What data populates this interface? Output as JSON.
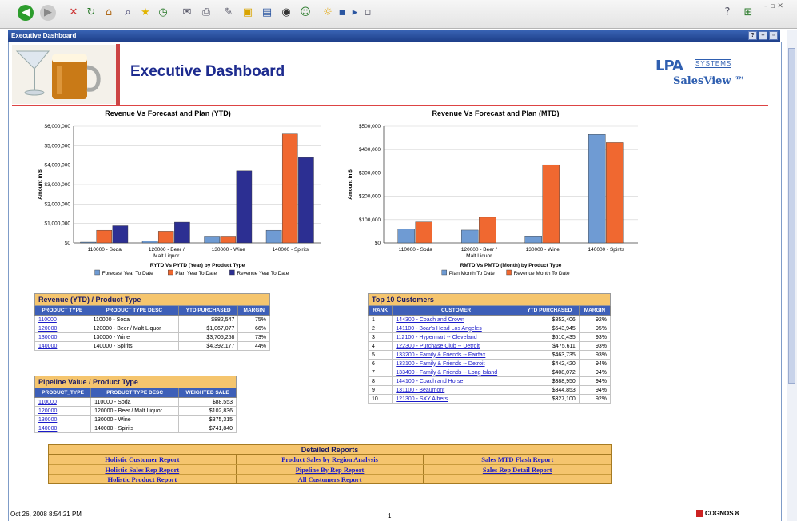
{
  "browser": {
    "toolbar_icons": [
      "back-icon",
      "forward-icon",
      "stop-icon",
      "refresh-icon",
      "home-icon",
      "search-icon",
      "favorites-icon",
      "history-icon",
      "mail-icon",
      "print-icon",
      "edit-icon",
      "discuss-icon",
      "folder-icon",
      "media-icon",
      "messenger-icon",
      "sun-icon",
      "display-icon",
      "play-icon",
      "doc-icon"
    ],
    "window_title": "Executive Dashboard"
  },
  "header": {
    "title": "Executive Dashboard",
    "logo_main": "LPA",
    "logo_systems": "SYSTEMS",
    "logo_sub": "SalesView ™"
  },
  "chart_data": [
    {
      "type": "bar",
      "title": "Revenue Vs Forecast and Plan (YTD)",
      "xlabel": "RYTD Vs PYTD (Year) by Product Type",
      "ylabel": "Amount in $",
      "categories": [
        "110000 - Soda",
        "120000 - Beer / Malt Liquor",
        "130000 - Wine",
        "140000 - Spirits"
      ],
      "series": [
        {
          "name": "Forecast Year To Date",
          "color": "#6f9bd3",
          "values": [
            40000,
            90000,
            350000,
            650000
          ]
        },
        {
          "name": "Plan Year To Date",
          "color": "#f06830",
          "values": [
            650000,
            600000,
            350000,
            5600000
          ]
        },
        {
          "name": "Revenue Year To Date",
          "color": "#2c2f92",
          "values": [
            882547,
            1067077,
            3705258,
            4392177
          ]
        }
      ],
      "ylim": [
        0,
        6000000
      ],
      "yticks": [
        "$0",
        "$1,000,000",
        "$2,000,000",
        "$3,000,000",
        "$4,000,000",
        "$5,000,000",
        "$6,000,000"
      ],
      "grid": true,
      "legend": "bottom"
    },
    {
      "type": "bar",
      "title": "Revenue Vs Forecast and Plan (MTD)",
      "xlabel": "RMTD Vs PMTD (Month) by Product Type",
      "ylabel": "Amount in $",
      "categories": [
        "110000 - Soda",
        "120000 - Beer / Malt Liquor",
        "130000 - Wine",
        "140000 - Spirits"
      ],
      "series": [
        {
          "name": "Plan Month To Date",
          "color": "#6f9bd3",
          "values": [
            60000,
            55000,
            30000,
            465000
          ]
        },
        {
          "name": "Revenue Month To Date",
          "color": "#f06830",
          "values": [
            90000,
            110000,
            335000,
            430000
          ]
        }
      ],
      "ylim": [
        0,
        500000
      ],
      "yticks": [
        "$0",
        "$100,000",
        "$200,000",
        "$300,000",
        "$400,000",
        "$500,000"
      ],
      "grid": true,
      "legend": "bottom"
    }
  ],
  "revenue_table": {
    "title": "Revenue (YTD) / Product Type",
    "headers": [
      "PRODUCT TYPE",
      "PRODUCT TYPE DESC",
      "YTD PURCHASED",
      "MARGIN"
    ],
    "rows": [
      [
        "110000",
        "110000 - Soda",
        "$882,547",
        "75%"
      ],
      [
        "120000",
        "120000 - Beer / Malt Liquor",
        "$1,067,077",
        "66%"
      ],
      [
        "130000",
        "130000 - Wine",
        "$3,705,258",
        "73%"
      ],
      [
        "140000",
        "140000 - Spirits",
        "$4,392,177",
        "44%"
      ]
    ]
  },
  "pipeline_table": {
    "title": "Pipeline Value / Product Type",
    "headers": [
      "PRODUCT_TYPE",
      "PRODUCT TYPE DESC",
      "WEIGHTED SALE"
    ],
    "rows": [
      [
        "110000",
        "110000 - Soda",
        "$88,553"
      ],
      [
        "120000",
        "120000 - Beer / Malt Liquor",
        "$102,836"
      ],
      [
        "130000",
        "130000 - Wine",
        "$375,315"
      ],
      [
        "140000",
        "140000 - Spirits",
        "$741,840"
      ]
    ]
  },
  "customers_table": {
    "title": "Top 10 Customers",
    "headers": [
      "RANK",
      "CUSTOMER",
      "YTD PURCHASED",
      "MARGIN"
    ],
    "rows": [
      [
        "1",
        "144300 - Coach and Crown",
        "$852,406",
        "92%"
      ],
      [
        "2",
        "141100 - Boar's Head Los Angeles",
        "$643,945",
        "95%"
      ],
      [
        "3",
        "112100 - Hypermart -- Cleveland",
        "$610,435",
        "93%"
      ],
      [
        "4",
        "122300 - Purchase Club -- Detroit",
        "$475,611",
        "93%"
      ],
      [
        "5",
        "133200 - Family & Friends -- Fairfax",
        "$463,735",
        "93%"
      ],
      [
        "6",
        "133100 - Family & Friends -- Detroit",
        "$442,420",
        "94%"
      ],
      [
        "7",
        "133400 - Family & Friends -- Long Island",
        "$408,072",
        "94%"
      ],
      [
        "8",
        "144100 - Coach and Horse",
        "$388,950",
        "94%"
      ],
      [
        "9",
        "131100 - Beaumont",
        "$344,853",
        "94%"
      ],
      [
        "10",
        "121300 - SXY Albers",
        "$327,100",
        "92%"
      ]
    ]
  },
  "reports": {
    "title": "Detailed Reports",
    "rows": [
      [
        "Holistic Customer Report",
        "Product Sales by Region Analysis",
        "Sales MTD Flash Report"
      ],
      [
        "Holistic Sales Rep Report",
        "Pipeline By Rep Report",
        "Sales Rep Detail Report"
      ],
      [
        "Holistic Product Report",
        "All Customers Report",
        ""
      ]
    ]
  },
  "footer": {
    "timestamp": "Oct 26, 2008 8:54:21 PM",
    "page": "1",
    "brand": "COGNOS 8"
  }
}
